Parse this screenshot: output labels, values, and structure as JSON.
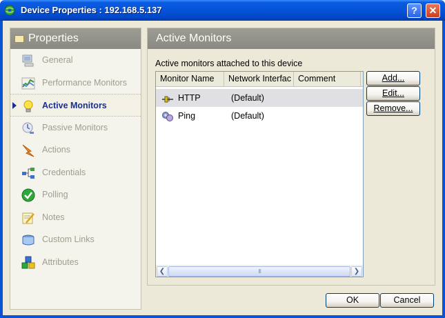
{
  "window": {
    "title": "Device Properties : 192.168.5.137",
    "help_label": "?",
    "close_label": "✕"
  },
  "left_panel": {
    "header": "Properties",
    "items": [
      {
        "label": "General",
        "icon": "computer-icon"
      },
      {
        "label": "Performance Monitors",
        "icon": "performance-chart-icon"
      },
      {
        "label": "Active Monitors",
        "icon": "lightbulb-icon",
        "active": true
      },
      {
        "label": "Passive Monitors",
        "icon": "passive-monitor-icon"
      },
      {
        "label": "Actions",
        "icon": "actions-lightning-icon"
      },
      {
        "label": "Credentials",
        "icon": "credentials-network-icon"
      },
      {
        "label": "Polling",
        "icon": "polling-checkmark-icon"
      },
      {
        "label": "Notes",
        "icon": "notes-pencil-icon"
      },
      {
        "label": "Custom Links",
        "icon": "custom-links-icon"
      },
      {
        "label": "Attributes",
        "icon": "attributes-blocks-icon"
      }
    ]
  },
  "right_panel": {
    "header": "Active Monitors",
    "caption": "Active monitors attached to this device",
    "columns": [
      "Monitor Name",
      "Network Interfac",
      "Comment"
    ],
    "rows": [
      {
        "name": "HTTP",
        "interface": "(Default)",
        "comment": "",
        "icon": "http-monitor-icon",
        "selected": true
      },
      {
        "name": "Ping",
        "interface": "(Default)",
        "comment": "",
        "icon": "ping-monitor-icon",
        "selected": false
      }
    ],
    "scroll_thumb_grip": "III",
    "buttons": {
      "add": "Add...",
      "edit": "Edit...",
      "remove": "Remove..."
    }
  },
  "footer": {
    "ok": "OK",
    "cancel": "Cancel"
  },
  "colors": {
    "titlebar": "#0553d8",
    "panel_header": "#8a8a82",
    "active_item": "#1b2f8a",
    "dialog_bg": "#ece9d8"
  }
}
